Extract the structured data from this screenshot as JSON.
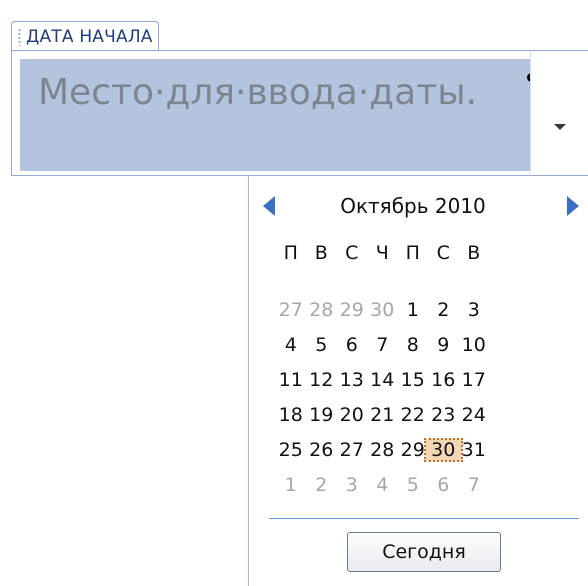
{
  "content_control": {
    "title": "ДАТА НАЧАЛА",
    "placeholder": "Место·для·ввода·даты."
  },
  "calendar": {
    "month_label": "Октябрь 2010",
    "weekdays": [
      "П",
      "В",
      "С",
      "Ч",
      "П",
      "С",
      "В"
    ],
    "weeks": [
      [
        "27",
        "28",
        "29",
        "30",
        "1",
        "2",
        "3"
      ],
      [
        "4",
        "5",
        "6",
        "7",
        "8",
        "9",
        "10"
      ],
      [
        "11",
        "12",
        "13",
        "14",
        "15",
        "16",
        "17"
      ],
      [
        "18",
        "19",
        "20",
        "21",
        "22",
        "23",
        "24"
      ],
      [
        "25",
        "26",
        "27",
        "28",
        "29",
        "30",
        "31"
      ],
      [
        "1",
        "2",
        "3",
        "4",
        "5",
        "6",
        "7"
      ]
    ],
    "today_button": "Сегодня",
    "selected_day": "30"
  },
  "icons": {
    "prev": "chevron-left-icon",
    "next": "chevron-right-icon",
    "dropdown": "caret-down-icon"
  },
  "colors": {
    "field_highlight": "#b4c4de",
    "nav_arrow": "#3b6fc4",
    "border": "#8daad8"
  }
}
